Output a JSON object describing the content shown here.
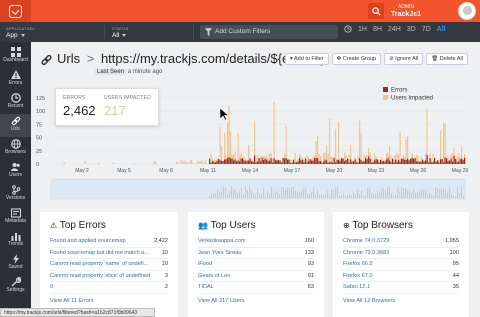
{
  "header": {
    "role": "ADMIN",
    "user": "TrackJs1",
    "search_icon": "search-icon"
  },
  "filterbar": {
    "application_label": "APPLICATION",
    "application_value": "App",
    "status_label": "STATUS",
    "status_value": "All",
    "add_filters_placeholder": "Add Custom Filters",
    "ranges": [
      "1H",
      "8H",
      "24H",
      "3D",
      "7D",
      "All"
    ],
    "active_range": "All"
  },
  "sidebar": {
    "items": [
      {
        "label": "Dashboard",
        "icon": "dashboard-icon"
      },
      {
        "label": "Errors",
        "icon": "errors-icon"
      },
      {
        "label": "Recent",
        "icon": "clock-icon"
      },
      {
        "label": "Urls",
        "icon": "link-icon"
      },
      {
        "label": "Browsers",
        "icon": "globe-icon"
      },
      {
        "label": "Users",
        "icon": "users-icon"
      },
      {
        "label": "Versions",
        "icon": "versions-icon"
      },
      {
        "label": "Metadata",
        "icon": "metadata-icon"
      },
      {
        "label": "Trends",
        "icon": "trends-icon"
      },
      {
        "label": "Saved",
        "icon": "saved-icon"
      },
      {
        "label": "Settings",
        "icon": "settings-icon"
      }
    ],
    "active": "Urls"
  },
  "page": {
    "title": "Urls",
    "url": "https://my.trackjs.com/details/${errorId}",
    "last_seen_label": "Last Seen",
    "last_seen_value": "a minute ago",
    "buttons": [
      "Add to Filter",
      "Create Group",
      "Ignore All",
      "Delete All"
    ]
  },
  "stats": {
    "errors_label": "ERRORS",
    "errors_value": "2,462",
    "users_label": "USERS IMPACTED",
    "users_value": "217"
  },
  "chart_data": {
    "type": "bar",
    "x_ticks": [
      "May 2",
      "May 5",
      "May 8",
      "May 11",
      "May 14",
      "May 17",
      "May 20",
      "May 23",
      "May 26",
      "May 29"
    ],
    "y_ticks": [
      0,
      25,
      50,
      75,
      100,
      125
    ],
    "ylim": [
      0,
      125
    ],
    "legend": [
      "Errors",
      "Users Impacted"
    ],
    "legend_position": "top-right",
    "series_colors": {
      "Errors": "#9b2b1e",
      "Users Impacted": "#efc68f"
    },
    "series": [
      {
        "name": "Errors",
        "values_note": ""
      },
      {
        "name": "Users Impacted",
        "values_note": ""
      }
    ]
  },
  "top_errors": {
    "title": "Top Errors",
    "rows": [
      {
        "label": "Found and applied sourcemap",
        "count": "2,422"
      },
      {
        "label": "Found sourcemap but did not match a...",
        "count": "10"
      },
      {
        "label": "Cannot read property 'name' of undefi...",
        "count": "10"
      },
      {
        "label": "Cannot read property 'slice' of undefined",
        "count": "3"
      },
      {
        "label": "0",
        "count": "2"
      }
    ],
    "view_all": "View All 11 Errors"
  },
  "top_users": {
    "title": "Top Users",
    "rows": [
      {
        "label": "Verkkokauppa.com",
        "count": "160"
      },
      {
        "label": "Jean Yves Sireau",
        "count": "133"
      },
      {
        "label": "iFood",
        "count": "93"
      },
      {
        "label": "Gears of Leo",
        "count": "91"
      },
      {
        "label": "TIDAL",
        "count": "83"
      }
    ],
    "view_all": "View All 217 Users"
  },
  "top_browsers": {
    "title": "Top Browsers",
    "rows": [
      {
        "label": "Chrome 74.0.3729",
        "count": "1,955"
      },
      {
        "label": "Chrome 73.0.3683",
        "count": "100"
      },
      {
        "label": "Firefox 66.0",
        "count": "95"
      },
      {
        "label": "Firefox 67.0",
        "count": "44"
      },
      {
        "label": "Safari 12.1",
        "count": "35"
      }
    ],
    "view_all": "View All 12 Browsers"
  },
  "statusbar": "https://my.trackjs.com/urls/filtered?hash=a162c871f0b09643"
}
